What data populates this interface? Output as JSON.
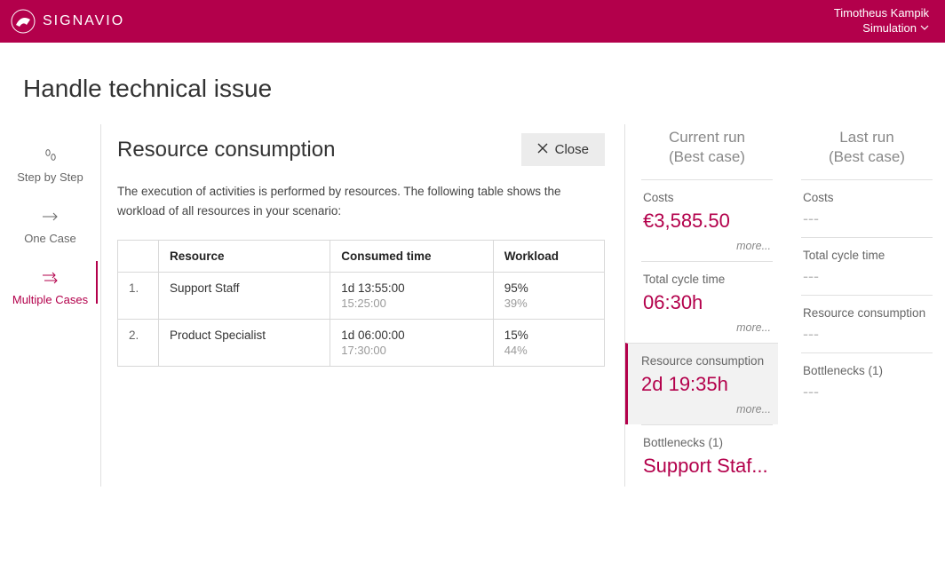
{
  "header": {
    "brand": "SIGNAVIO",
    "user_name": "Timotheus Kampik",
    "sim_label": "Simulation"
  },
  "page_title": "Handle technical issue",
  "tabs": {
    "step": "Step by Step",
    "one": "One Case",
    "multi": "Multiple Cases"
  },
  "panel": {
    "title": "Resource consumption",
    "close": "Close",
    "desc": "The execution of activities is performed by resources. The following table shows the workload of all resources in your scenario:",
    "cols": {
      "idx": "",
      "resource": "Resource",
      "consumed": "Consumed time",
      "workload": "Workload"
    },
    "rows": [
      {
        "idx": "1.",
        "resource": "Support Staff",
        "t1": "1d 13:55:00",
        "t2": "15:25:00",
        "w1": "95%",
        "w2": "39%"
      },
      {
        "idx": "2.",
        "resource": "Product Specialist",
        "t1": "1d 06:00:00",
        "t2": "17:30:00",
        "w1": "15%",
        "w2": "44%"
      }
    ]
  },
  "metrics": {
    "more": "more...",
    "empty": "---",
    "current": {
      "title": "Current run",
      "subtitle": "(Best case)",
      "costs_label": "Costs",
      "costs_value": "€3,585.50",
      "cycle_label": "Total cycle time",
      "cycle_value": "06:30h",
      "rc_label": "Resource consumption",
      "rc_value": "2d 19:35h",
      "bn_label": "Bottlenecks (1)",
      "bn_value": "Support Staf..."
    },
    "last": {
      "title": "Last run",
      "subtitle": "(Best case)",
      "costs_label": "Costs",
      "cycle_label": "Total cycle time",
      "rc_label": "Resource consumption",
      "bn_label": "Bottlenecks (1)"
    }
  }
}
